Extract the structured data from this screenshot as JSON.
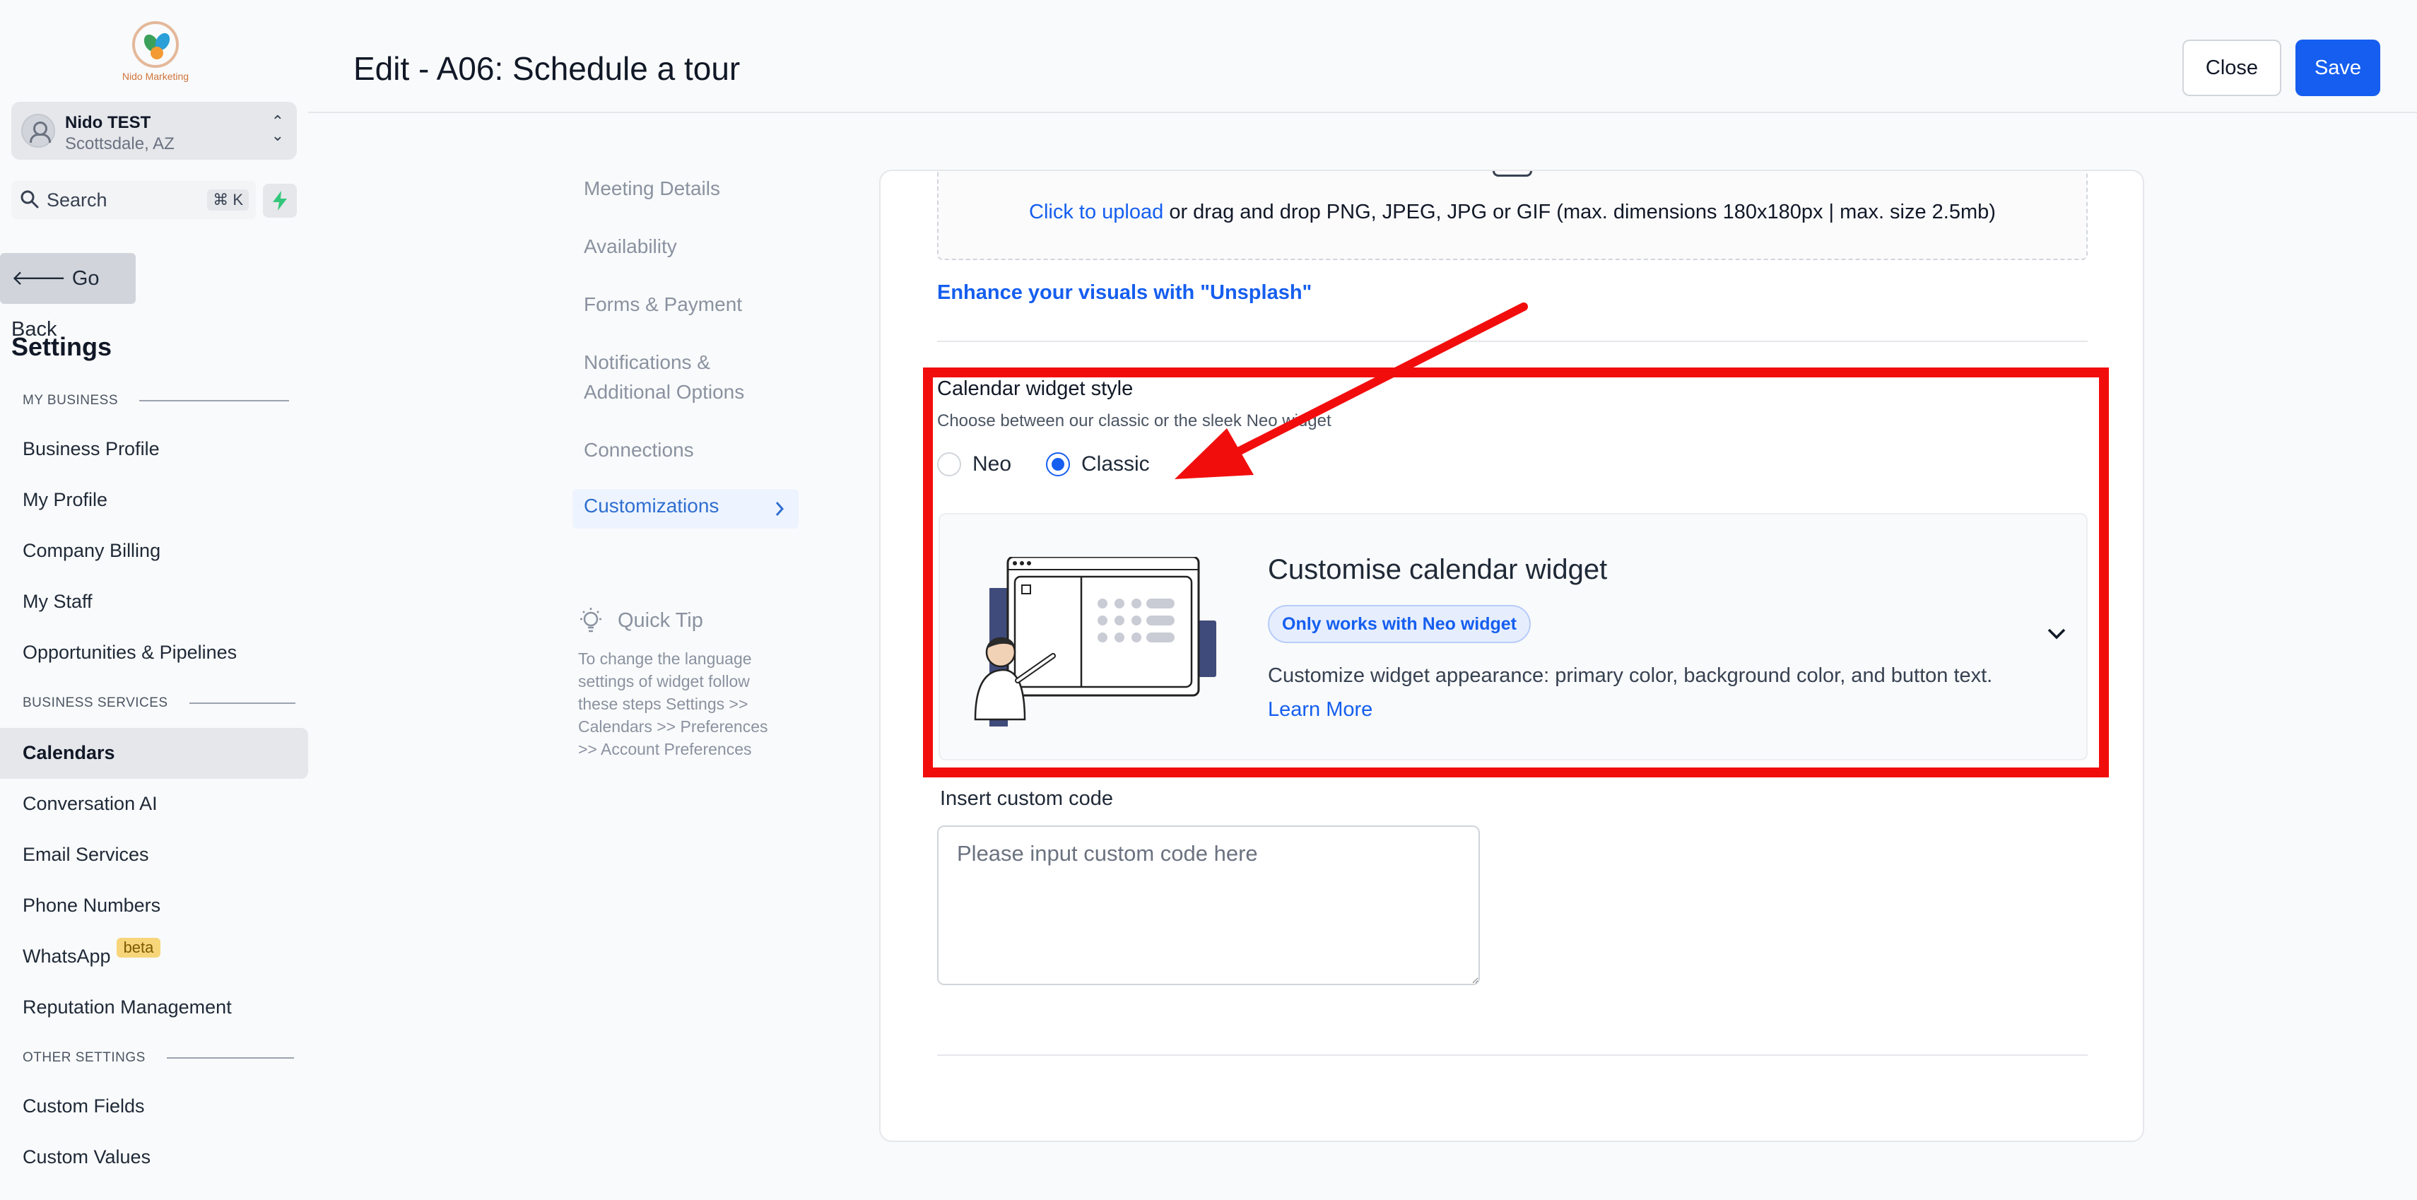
{
  "sidebar": {
    "logo_text": "Nido Marketing",
    "location": {
      "name": "Nido TEST",
      "city": "Scottsdale, AZ"
    },
    "search": {
      "label": "Search",
      "shortcut": "⌘ K"
    },
    "go_back": "Go Back",
    "title": "Settings",
    "sections": {
      "my_business": "MY BUSINESS",
      "business_services": "BUSINESS SERVICES",
      "other_settings": "OTHER SETTINGS"
    },
    "items": {
      "business_profile": "Business Profile",
      "my_profile": "My Profile",
      "company_billing": "Company Billing",
      "my_staff": "My Staff",
      "opportunities": "Opportunities & Pipelines",
      "calendars": "Calendars",
      "conversation_ai": "Conversation AI",
      "email_services": "Email Services",
      "phone_numbers": "Phone Numbers",
      "whatsapp": "WhatsApp",
      "whatsapp_badge": "beta",
      "reputation": "Reputation Management",
      "custom_fields": "Custom Fields",
      "custom_values": "Custom Values"
    },
    "active_item": "Calendars"
  },
  "header": {
    "title": "Edit - A06: Schedule a tour",
    "close_label": "Close",
    "save_label": "Save"
  },
  "steps": {
    "items": [
      "Meeting Details",
      "Availability",
      "Forms & Payment",
      "Notifications &",
      "Additional Options",
      "Connections"
    ],
    "active": "Customizations"
  },
  "quick_tip": {
    "title": "Quick Tip",
    "body": "To change the language settings of widget follow these steps Settings >> Calendars >> Preferences >> Account Preferences"
  },
  "main": {
    "upload": {
      "link": "Click to upload",
      "rest": " or drag and drop PNG, JPEG, JPG or GIF (max. dimensions 180x180px | max. size 2.5mb)"
    },
    "unsplash_link": "Enhance your visuals with \"Unsplash\"",
    "widget_style": {
      "title": "Calendar widget style",
      "subtitle": "Choose between our classic or the sleek Neo widget",
      "options": {
        "neo": "Neo",
        "classic": "Classic"
      },
      "selected": "Classic"
    },
    "customise": {
      "title": "Customise calendar widget",
      "badge": "Only works with Neo widget",
      "description": "Customize widget appearance: primary color, background color, and button text.",
      "learn_more": "Learn More"
    },
    "custom_code": {
      "label": "Insert custom code",
      "placeholder": "Please input custom code here",
      "value": ""
    }
  },
  "colors": {
    "primary": "#155eef",
    "annotation": "#f20d0d",
    "beta_badge": "#f7d57a"
  }
}
